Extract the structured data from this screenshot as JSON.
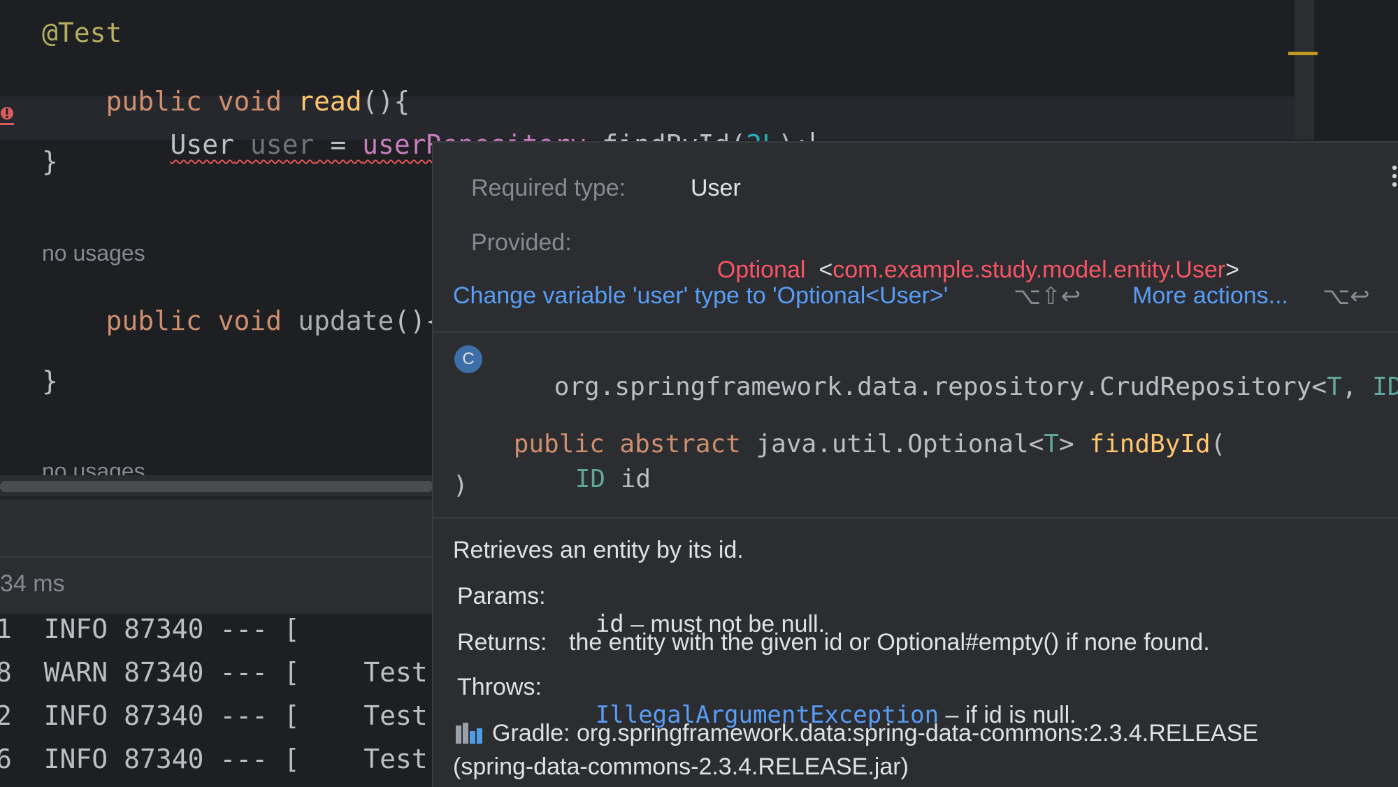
{
  "editor": {
    "annotation": "@Test",
    "read_kw": "public void ",
    "read_name": "read",
    "read_paren": "(){",
    "stmt_type": "User",
    "stmt_var": "user",
    "stmt_eq": " = ",
    "stmt_field": "userRepository",
    "stmt_call": ".findById(",
    "stmt_num": "2L",
    "stmt_end": ");",
    "close_brace": "}",
    "hint_usages": "no usages",
    "update_kw": "public void ",
    "update_name": "update",
    "update_paren": "(){",
    "close_brace2": "}",
    "hint_usages2": "no usages"
  },
  "tool_window": {
    "duration": "34 ms",
    "log_lines": [
      {
        "prefix": "1",
        "level": "INFO",
        "pid": "87340",
        "sep": "--- [",
        "thread": ""
      },
      {
        "prefix": "8",
        "level": "WARN",
        "pid": "87340",
        "sep": "--- [",
        "thread": "Test"
      },
      {
        "prefix": "2",
        "level": "INFO",
        "pid": "87340",
        "sep": "--- [",
        "thread": "Test"
      },
      {
        "prefix": "6",
        "level": "INFO",
        "pid": "87340",
        "sep": "--- [",
        "thread": "Test"
      }
    ]
  },
  "popup": {
    "required_label": "Required type:",
    "required_value": "User",
    "provided_label": "Provided:",
    "provided_type": "Optional",
    "provided_generic_open": "<",
    "provided_generic_type": "com.example.study.model.entity.User",
    "provided_generic_close": ">",
    "fix_action": "Change variable 'user' type to 'Optional<User>'",
    "fix_shortcut": "⌥⇧↩",
    "more_actions": "More actions...",
    "more_shortcut": "⌥↩",
    "class_icon": "C",
    "class_name": "org.springframework.data.repository.CrudRepository<",
    "class_tparam_t": "T",
    "class_comma": ", ",
    "class_tparam_id": "ID",
    "class_close": ">",
    "sig_mods": "public abstract ",
    "sig_ret": "java.util.Optional<",
    "sig_ret_t": "T",
    "sig_ret_close": "> ",
    "sig_method": "findById",
    "sig_open": "(",
    "sig_param_type": "ID",
    "sig_param_name": " id",
    "sig_close": ")",
    "doc_summary": "Retrieves an entity by its id.",
    "params_label": "Params:",
    "params_name": "id",
    "params_desc": " – must not be null.",
    "returns_label": "Returns:",
    "returns_desc": "the entity with the given id or Optional#empty() if none found.",
    "throws_label": "Throws:",
    "throws_exc": "IllegalArgumentException",
    "throws_desc": " – if id is null.",
    "gradle_line1": "Gradle: org.springframework.data:spring-data-commons:2.3.4.RELEASE",
    "gradle_line2": "(spring-data-commons-2.3.4.RELEASE.jar)"
  }
}
